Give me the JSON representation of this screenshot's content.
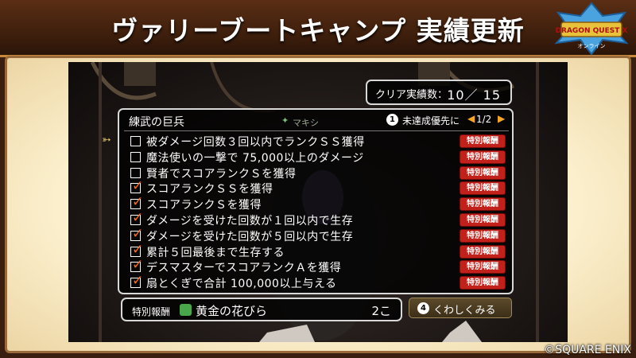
{
  "header": {
    "title": "ヴァリーブートキャンプ 実績更新"
  },
  "logo": {
    "text": "DRAGON QUEST X",
    "subtitle": "オンライン"
  },
  "achievements": {
    "clear_label": "クリア実績数：",
    "clear_count": "10／ 15"
  },
  "list": {
    "title": "練武の巨兵",
    "character_name": "マキシ",
    "sort_badge": "1",
    "sort_label": "未達成優先に",
    "page": "1/2",
    "reward_badge_label": "特別報酬",
    "items": [
      {
        "text": "被ダメージ回数３回以内でランクＳＳ獲得",
        "checked": false
      },
      {
        "text": "魔法使いの一撃で 75,000以上のダメージ",
        "checked": false
      },
      {
        "text": "賢者でスコアランクＳを獲得",
        "checked": false
      },
      {
        "text": "スコアランクＳＳを獲得",
        "checked": true
      },
      {
        "text": "スコアランクＳを獲得",
        "checked": true
      },
      {
        "text": "ダメージを受けた回数が１回以内で生存",
        "checked": true
      },
      {
        "text": "ダメージを受けた回数が５回以内で生存",
        "checked": true
      },
      {
        "text": "累計５回最後まで生存する",
        "checked": true
      },
      {
        "text": "デスマスターでスコアランクＡを獲得",
        "checked": true
      },
      {
        "text": "扇とくぎで合計 100,000以上与える",
        "checked": true
      }
    ]
  },
  "reward": {
    "label": "特別報酬",
    "item_name": "黄金の花びら",
    "quantity": "2こ"
  },
  "detail": {
    "badge": "4",
    "label": "くわしくみる"
  },
  "copyright": "©SQUARE ENIX",
  "colors": {
    "checkmark": "#ff6a14",
    "reward_badge": "#c2211b",
    "page_arrow": "#f5a623"
  }
}
